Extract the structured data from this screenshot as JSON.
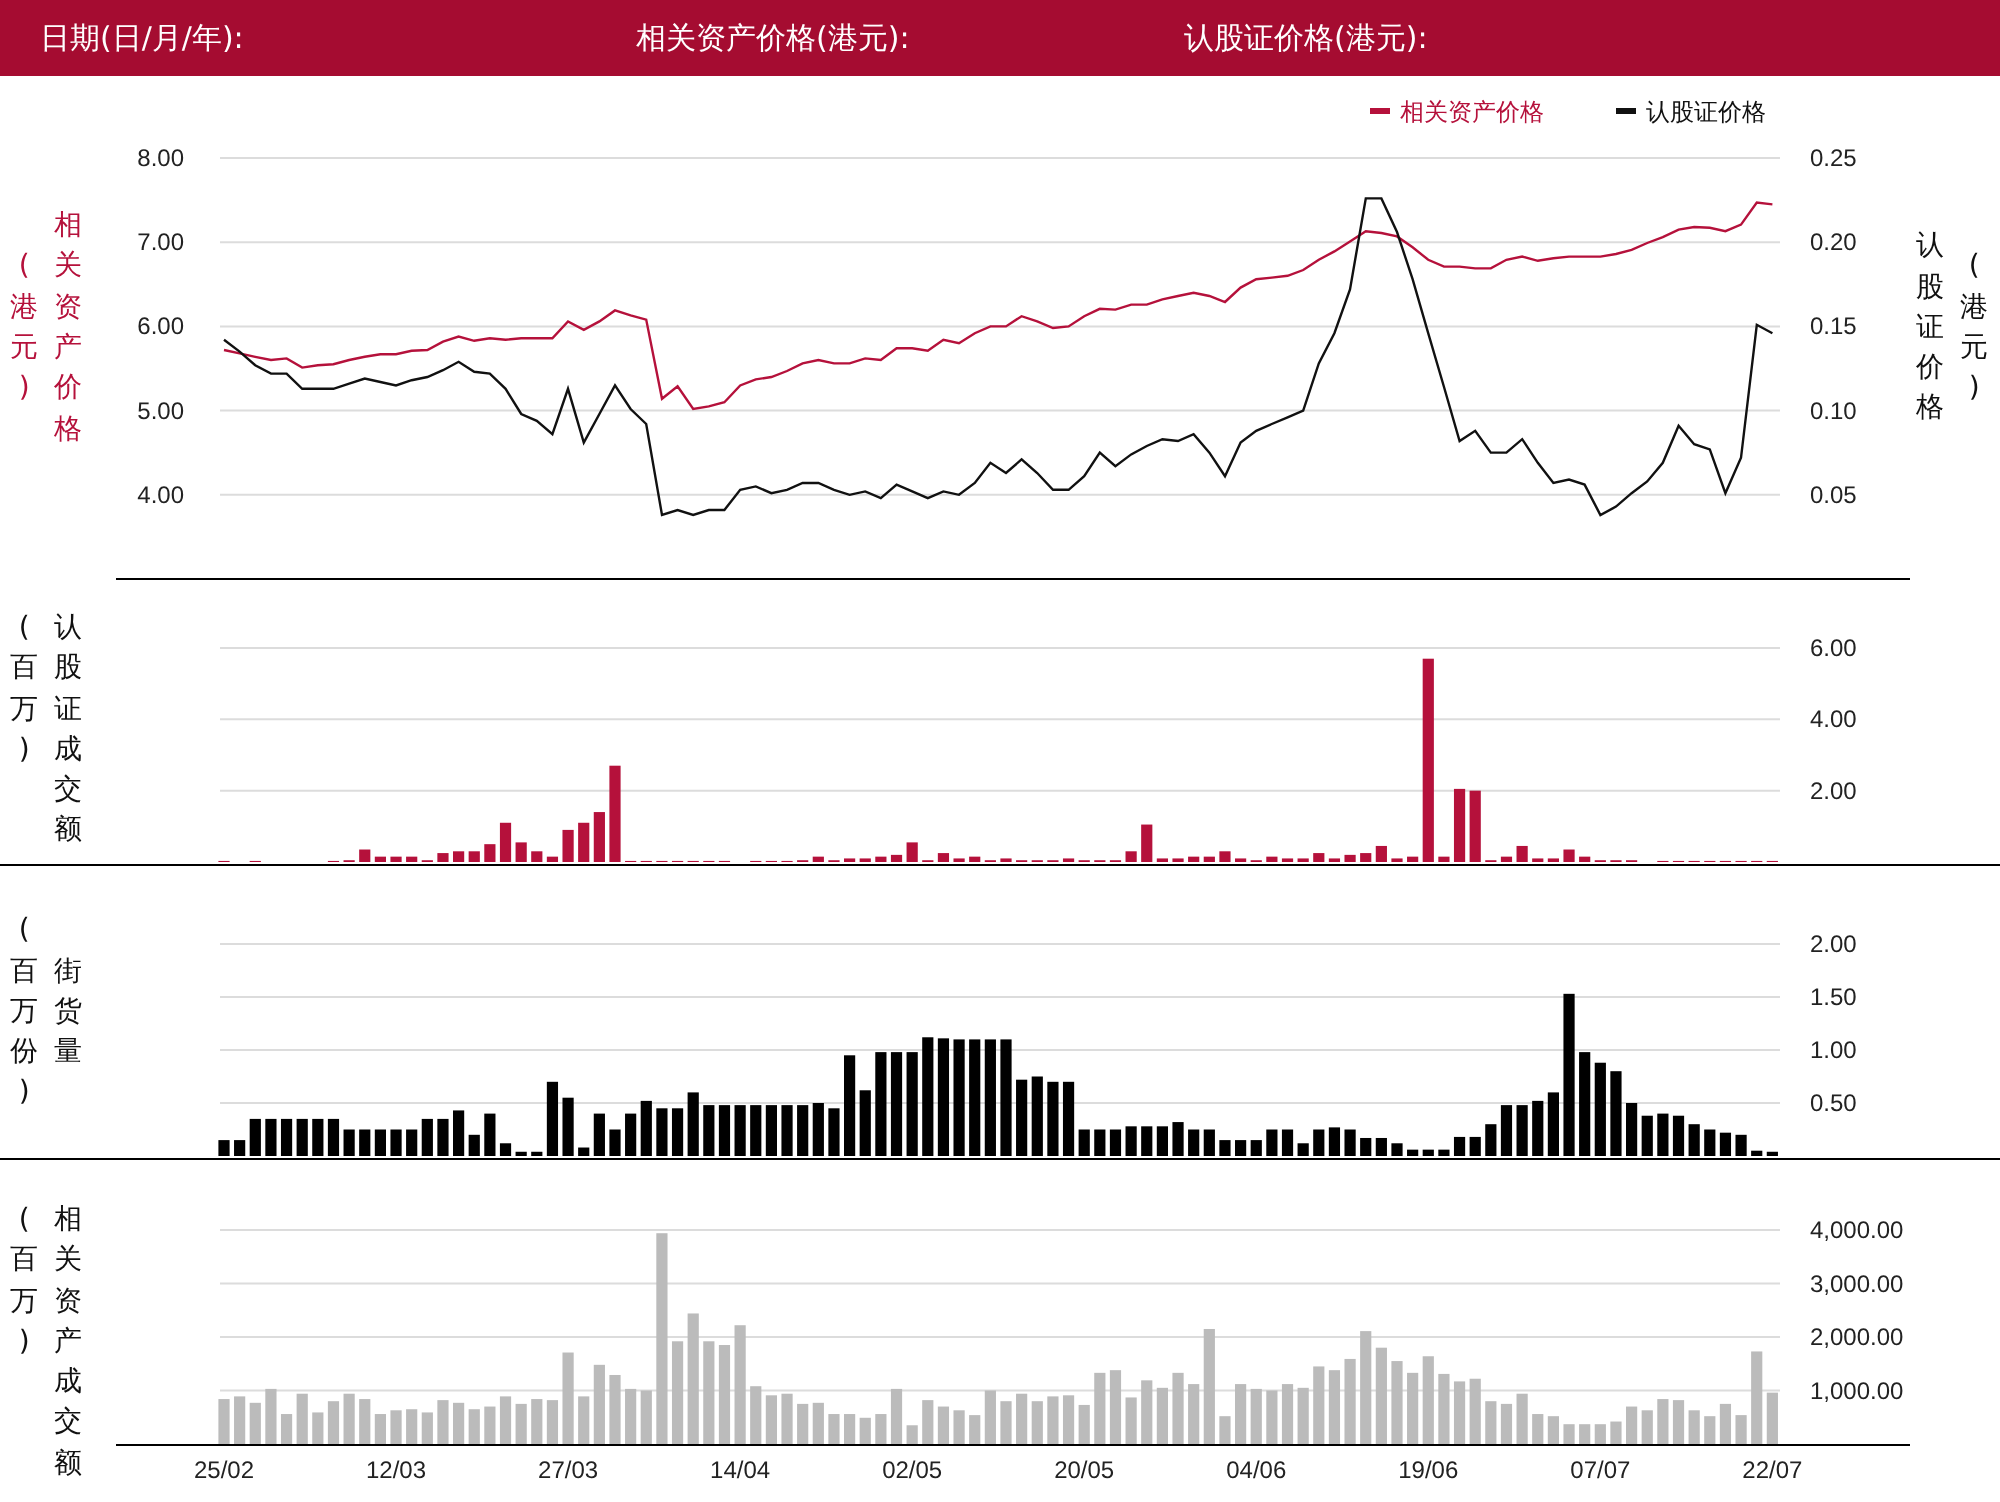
{
  "header": {
    "fields": [
      {
        "label": "日期(日/月/年):"
      },
      {
        "label": "相关资产价格(港元):"
      },
      {
        "label": "认股证价格(港元):"
      }
    ]
  },
  "price_panel": {
    "left_axis_unit": "(港元)",
    "right_axis_unit": "(港元)",
    "chart_data": {
      "type": "line",
      "grid": true,
      "legend": true,
      "ylim": [
        3,
        8
      ],
      "y2lim": [
        0,
        0.25
      ],
      "yticks": [
        {
          "value": 8,
          "label": "8.00"
        },
        {
          "value": 7,
          "label": "7.00"
        },
        {
          "value": 6,
          "label": "6.00"
        },
        {
          "value": 5,
          "label": "5.00"
        },
        {
          "value": 4,
          "label": "4.00"
        }
      ],
      "y2ticks": [
        {
          "value": 0.25,
          "label": "0.25"
        },
        {
          "value": 0.2,
          "label": "0.20"
        },
        {
          "value": 0.15,
          "label": "0.15"
        },
        {
          "value": 0.1,
          "label": "0.10"
        },
        {
          "value": 0.05,
          "label": "0.05"
        }
      ],
      "series": [
        {
          "name": "相关资产价格",
          "color": "#b5113b",
          "values": [
            5.72,
            5.68,
            5.64,
            5.6,
            5.62,
            5.51,
            5.54,
            5.55,
            5.6,
            5.64,
            5.67,
            5.67,
            5.71,
            5.72,
            5.82,
            5.88,
            5.83,
            5.86,
            5.84,
            5.86,
            5.86,
            5.86,
            6.06,
            5.96,
            6.06,
            6.19,
            6.13,
            6.08,
            5.14,
            5.29,
            5.02,
            5.05,
            5.1,
            5.3,
            5.37,
            5.4,
            5.47,
            5.56,
            5.6,
            5.56,
            5.56,
            5.62,
            5.6,
            5.74,
            5.74,
            5.71,
            5.84,
            5.8,
            5.92,
            6.0,
            6.0,
            6.12,
            6.06,
            5.98,
            6.0,
            6.12,
            6.21,
            6.2,
            6.26,
            6.26,
            6.32,
            6.36,
            6.4,
            6.36,
            6.29,
            6.46,
            6.56,
            6.58,
            6.6,
            6.67,
            6.79,
            6.89,
            7.01,
            7.13,
            7.11,
            7.07,
            6.94,
            6.79,
            6.71,
            6.71,
            6.69,
            6.69,
            6.79,
            6.83,
            6.78,
            6.81,
            6.83,
            6.83,
            6.83,
            6.86,
            6.91,
            6.99,
            7.06,
            7.15,
            7.18,
            7.17,
            7.13,
            7.21,
            7.47,
            7.45
          ]
        },
        {
          "name": "认股证价格",
          "color": "#111111",
          "axis": "y2",
          "values": [
            0.142,
            0.135,
            0.127,
            0.122,
            0.122,
            0.113,
            0.113,
            0.113,
            0.116,
            0.119,
            0.117,
            0.115,
            0.118,
            0.12,
            0.124,
            0.129,
            0.123,
            0.122,
            0.113,
            0.098,
            0.094,
            0.086,
            0.113,
            0.081,
            0.098,
            0.115,
            0.101,
            0.092,
            0.038,
            0.041,
            0.038,
            0.041,
            0.041,
            0.053,
            0.055,
            0.051,
            0.053,
            0.057,
            0.057,
            0.053,
            0.05,
            0.052,
            0.048,
            0.056,
            0.052,
            0.048,
            0.052,
            0.05,
            0.057,
            0.069,
            0.063,
            0.071,
            0.063,
            0.053,
            0.053,
            0.061,
            0.075,
            0.067,
            0.074,
            0.079,
            0.083,
            0.082,
            0.086,
            0.075,
            0.061,
            0.081,
            0.088,
            0.092,
            0.096,
            0.1,
            0.128,
            0.146,
            0.172,
            0.226,
            0.226,
            0.206,
            0.178,
            0.146,
            0.114,
            0.082,
            0.088,
            0.075,
            0.075,
            0.083,
            0.069,
            0.057,
            0.059,
            0.056,
            0.038,
            0.043,
            0.051,
            0.058,
            0.069,
            0.091,
            0.08,
            0.077,
            0.051,
            0.072,
            0.151,
            0.146
          ]
        }
      ]
    }
  },
  "warrant_turnover_panel": {
    "axis_unit": "(百万)",
    "chart_data": {
      "type": "bar",
      "grid": true,
      "ylim": [
        0,
        6
      ],
      "yticks": [
        {
          "value": 6,
          "label": "6.00"
        },
        {
          "value": 4,
          "label": "4.00"
        },
        {
          "value": 2,
          "label": "2.00"
        }
      ],
      "series": [
        {
          "name": "认股证成交额",
          "color": "#b5113b",
          "values": [
            0.03,
            0,
            0.03,
            0,
            0,
            0,
            0,
            0.03,
            0.05,
            0.35,
            0.15,
            0.15,
            0.15,
            0.05,
            0.25,
            0.3,
            0.3,
            0.5,
            1.1,
            0.55,
            0.3,
            0.15,
            0.9,
            1.1,
            1.4,
            2.7,
            0.03,
            0.03,
            0.03,
            0.03,
            0.03,
            0.03,
            0.03,
            0,
            0.03,
            0.03,
            0.03,
            0.05,
            0.15,
            0.05,
            0.1,
            0.1,
            0.15,
            0.2,
            0.55,
            0.05,
            0.25,
            0.1,
            0.15,
            0.05,
            0.1,
            0.05,
            0.05,
            0.05,
            0.1,
            0.05,
            0.05,
            0.05,
            0.3,
            1.05,
            0.1,
            0.1,
            0.15,
            0.15,
            0.3,
            0.1,
            0.05,
            0.15,
            0.1,
            0.1,
            0.25,
            0.1,
            0.2,
            0.25,
            0.45,
            0.1,
            0.15,
            5.7,
            0.15,
            2.05,
            2.0,
            0.05,
            0.15,
            0.45,
            0.1,
            0.1,
            0.35,
            0.15,
            0.05,
            0.05,
            0.05,
            0,
            0.03,
            0.03,
            0.03,
            0.03,
            0.03,
            0.03,
            0.03,
            0.03
          ]
        }
      ]
    }
  },
  "outstanding_panel": {
    "axis_unit": "(百万份)",
    "chart_data": {
      "type": "bar",
      "grid": true,
      "ylim": [
        0,
        2
      ],
      "yticks": [
        {
          "value": 2,
          "label": "2.00"
        },
        {
          "value": 1.5,
          "label": "1.50"
        },
        {
          "value": 1,
          "label": "1.00"
        },
        {
          "value": 0.5,
          "label": "0.50"
        }
      ],
      "series": [
        {
          "name": "街货量",
          "color": "#000000",
          "values": [
            0.15,
            0.15,
            0.35,
            0.35,
            0.35,
            0.35,
            0.35,
            0.35,
            0.25,
            0.25,
            0.25,
            0.25,
            0.25,
            0.35,
            0.35,
            0.43,
            0.2,
            0.4,
            0.12,
            0.04,
            0.04,
            0.7,
            0.55,
            0.08,
            0.4,
            0.25,
            0.4,
            0.52,
            0.45,
            0.45,
            0.6,
            0.48,
            0.48,
            0.48,
            0.48,
            0.48,
            0.48,
            0.48,
            0.5,
            0.45,
            0.95,
            0.62,
            0.98,
            0.98,
            0.98,
            1.12,
            1.11,
            1.1,
            1.1,
            1.1,
            1.1,
            0.72,
            0.75,
            0.7,
            0.7,
            0.25,
            0.25,
            0.25,
            0.28,
            0.28,
            0.28,
            0.32,
            0.25,
            0.25,
            0.15,
            0.15,
            0.15,
            0.25,
            0.25,
            0.12,
            0.25,
            0.27,
            0.25,
            0.17,
            0.17,
            0.12,
            0.06,
            0.06,
            0.06,
            0.18,
            0.18,
            0.3,
            0.48,
            0.48,
            0.52,
            0.6,
            1.53,
            0.98,
            0.88,
            0.8,
            0.5,
            0.38,
            0.4,
            0.38,
            0.3,
            0.25,
            0.22,
            0.2,
            0.05,
            0.04
          ]
        }
      ]
    }
  },
  "underlying_turnover_panel": {
    "axis_unit": "(百万)",
    "chart_data": {
      "type": "bar",
      "grid": true,
      "ylim": [
        0,
        4000
      ],
      "categories": [
        "25/02",
        null,
        null,
        null,
        null,
        null,
        null,
        null,
        null,
        null,
        null,
        "12/03",
        null,
        null,
        null,
        null,
        null,
        null,
        null,
        null,
        null,
        null,
        "27/03",
        null,
        null,
        null,
        null,
        null,
        null,
        null,
        null,
        null,
        null,
        "14/04",
        null,
        null,
        null,
        null,
        null,
        null,
        null,
        null,
        null,
        null,
        "02/05",
        null,
        null,
        null,
        null,
        null,
        null,
        null,
        null,
        null,
        null,
        "20/05",
        null,
        null,
        null,
        null,
        null,
        null,
        null,
        null,
        null,
        null,
        "04/06",
        null,
        null,
        null,
        null,
        null,
        null,
        null,
        null,
        null,
        null,
        "19/06",
        null,
        null,
        null,
        null,
        null,
        null,
        null,
        null,
        null,
        null,
        "07/07",
        null,
        null,
        null,
        null,
        null,
        null,
        null,
        null,
        null,
        null,
        "22/07"
      ],
      "yticks": [
        {
          "value": 4000,
          "label": "4,000.00"
        },
        {
          "value": 3000,
          "label": "3,000.00"
        },
        {
          "value": 2000,
          "label": "2,000.00"
        },
        {
          "value": 1000,
          "label": "1,000.00"
        }
      ],
      "series": [
        {
          "name": "相关资产成交额",
          "color": "#bbbbbb",
          "values": [
            840,
            890,
            770,
            1030,
            560,
            940,
            590,
            800,
            940,
            840,
            560,
            630,
            650,
            590,
            820,
            770,
            650,
            700,
            890,
            750,
            840,
            820,
            1710,
            890,
            1480,
            1290,
            1030,
            1000,
            3940,
            1920,
            2440,
            1920,
            1850,
            2220,
            1080,
            910,
            940,
            750,
            770,
            560,
            560,
            490,
            560,
            1030,
            350,
            820,
            700,
            630,
            540,
            1000,
            800,
            940,
            800,
            890,
            910,
            730,
            1330,
            1380,
            870,
            1190,
            1050,
            1330,
            1120,
            2150,
            520,
            1120,
            1030,
            1000,
            1120,
            1050,
            1450,
            1380,
            1590,
            2110,
            1800,
            1550,
            1330,
            1640,
            1310,
            1170,
            1220,
            800,
            750,
            940,
            560,
            520,
            370,
            370,
            370,
            420,
            700,
            630,
            840,
            820,
            630,
            520,
            750,
            540,
            1730,
            960
          ]
        }
      ]
    }
  }
}
